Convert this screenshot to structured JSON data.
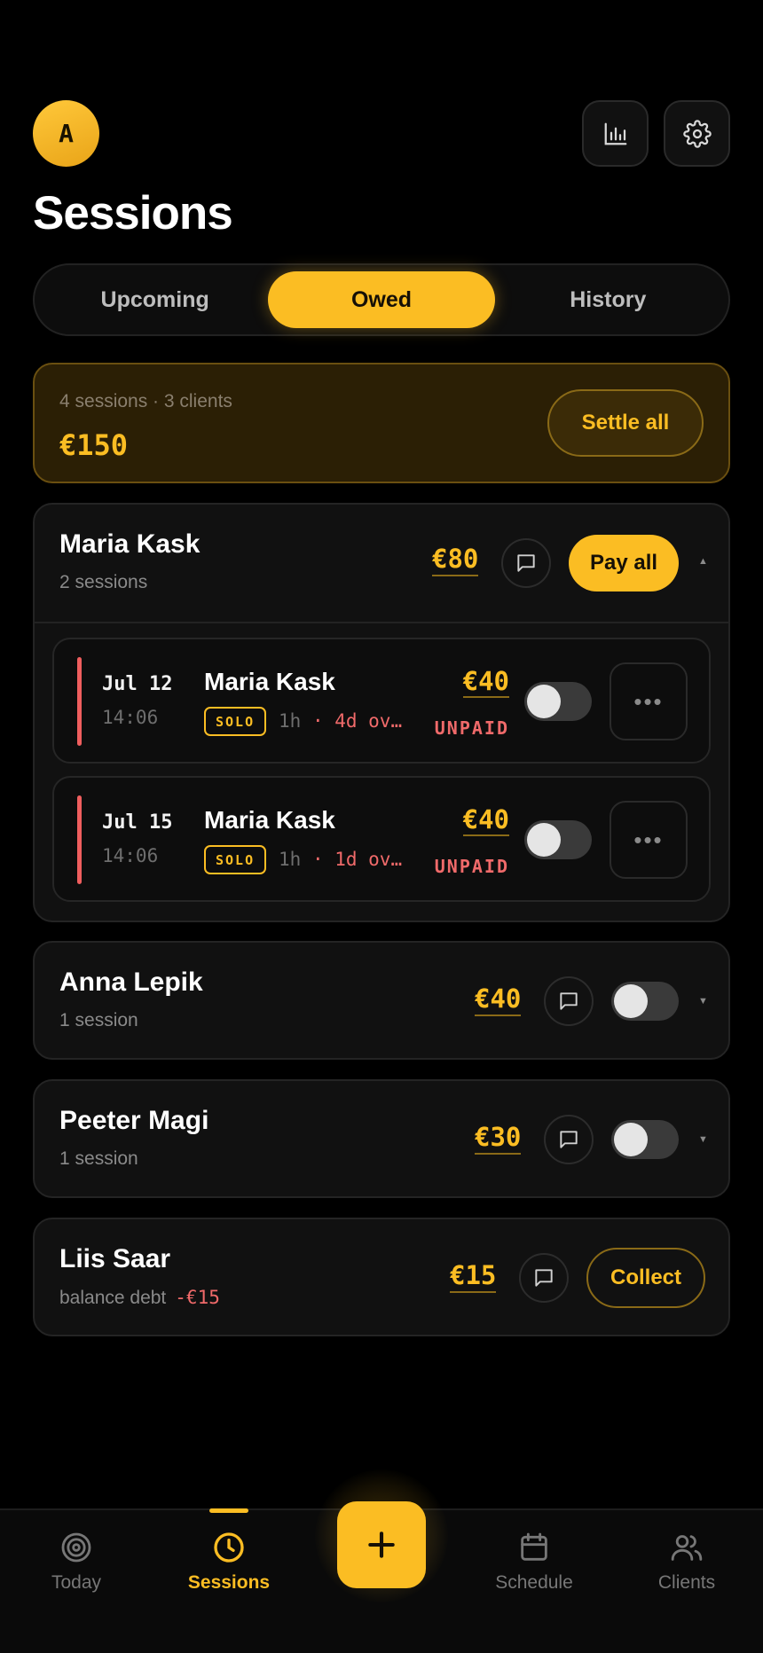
{
  "header": {
    "avatar_initial": "A",
    "title": "Sessions",
    "stats_icon": "bar-chart-icon",
    "settings_icon": "gear-icon"
  },
  "tabs": [
    {
      "label": "Upcoming",
      "active": false
    },
    {
      "label": "Owed",
      "active": true
    },
    {
      "label": "History",
      "active": false
    }
  ],
  "summary": {
    "meta": "4 sessions · 3 clients",
    "total": "€150",
    "settle_label": "Settle all"
  },
  "clients": [
    {
      "name": "Maria Kask",
      "sub": "2 sessions",
      "amount": "€80",
      "action_label": "Pay all",
      "expanded": true,
      "sessions": [
        {
          "date": "Jul 12",
          "time": "14:06",
          "name": "Maria Kask",
          "badge": "SOLO",
          "duration": "1h",
          "overdue": "· 4d ov…",
          "amount": "€40",
          "status": "UNPAID"
        },
        {
          "date": "Jul 15",
          "time": "14:06",
          "name": "Maria Kask",
          "badge": "SOLO",
          "duration": "1h",
          "overdue": "· 1d ov…",
          "amount": "€40",
          "status": "UNPAID"
        }
      ]
    },
    {
      "name": "Anna Lepik",
      "sub": "1 session",
      "amount": "€40"
    },
    {
      "name": "Peeter Magi",
      "sub": "1 session",
      "amount": "€30"
    },
    {
      "name": "Liis Saar",
      "sub": "balance debt",
      "debt": "-€15",
      "amount": "€15",
      "action_label": "Collect"
    }
  ],
  "nav": [
    {
      "label": "Today",
      "icon": "target-icon"
    },
    {
      "label": "Sessions",
      "icon": "clock-icon",
      "active": true
    },
    {
      "label": "Schedule",
      "icon": "calendar-icon"
    },
    {
      "label": "Clients",
      "icon": "users-icon"
    }
  ],
  "fab_icon": "plus-icon",
  "colors": {
    "accent": "#fbbd23",
    "unpaid": "#f06a6a",
    "background": "#000000",
    "card": "#111111"
  }
}
